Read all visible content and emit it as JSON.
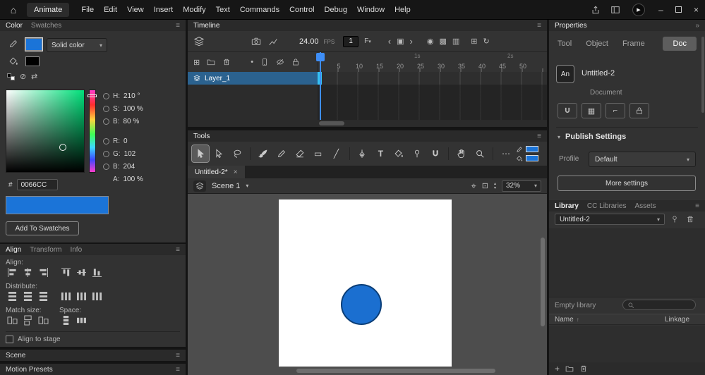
{
  "app": {
    "name": "Animate"
  },
  "menubar": {
    "items": [
      "File",
      "Edit",
      "View",
      "Insert",
      "Modify",
      "Text",
      "Commands",
      "Control",
      "Debug",
      "Window",
      "Help"
    ]
  },
  "icons": {
    "home": "⌂",
    "hamburger": "≡",
    "double_chevron": "»",
    "chevron_down": "▾",
    "close": "×",
    "minimize": "–",
    "play": "▶",
    "prev": "‹",
    "next": "›",
    "current_frame": "▣",
    "onion": "◉",
    "onion_outline": "▩",
    "edit_multiple": "▥",
    "insert_frame": "⊞",
    "loop": "↻",
    "add_layer": "⊞",
    "dot": "•",
    "rect_tool": "▭",
    "line_tool": "╱",
    "text_tool": "T",
    "more_tools": "⋯",
    "center_stage": "⌖",
    "clip": "⊡",
    "spin_up": "▴",
    "spin_down": "▾",
    "swap": "⇄",
    "no_color": "⊘",
    "up_arrow": "↑",
    "corner": "⌐",
    "grid": "▦",
    "plus": "+"
  },
  "color_panel": {
    "tab_color": "Color",
    "tab_swatches": "Swatches",
    "fill_style": "Solid color",
    "h_label": "H:",
    "h_value": "210 °",
    "s_label": "S:",
    "s_value": "100 %",
    "b_label": "B:",
    "b_value": "80 %",
    "r_label": "R:",
    "r_value": "0",
    "g_label": "G:",
    "g_value": "102",
    "b2_label": "B:",
    "b2_value": "204",
    "a_label": "A:",
    "a_value": "100 %",
    "hex_prefix": "#",
    "hex_value": "0066CC",
    "add_to_swatches": "Add To Swatches"
  },
  "align_panel": {
    "tab_align": "Align",
    "tab_transform": "Transform",
    "tab_info": "Info",
    "align_label": "Align:",
    "distribute_label": "Distribute:",
    "match_label": "Match size:",
    "space_label": "Space:",
    "align_to_stage": "Align to stage"
  },
  "left_bottom": {
    "scene": "Scene",
    "motion_presets": "Motion Presets"
  },
  "timeline": {
    "title": "Timeline",
    "fps_value": "24.00",
    "fps_unit": "FPS",
    "frame_number": "1",
    "frame_flag": "F",
    "seconds": {
      "s1": "1s",
      "s2": "2s"
    },
    "ruler": [
      "5",
      "10",
      "15",
      "20",
      "25",
      "30",
      "35",
      "40",
      "45",
      "50"
    ],
    "layer_name": "Layer_1"
  },
  "tools_panel": {
    "title": "Tools"
  },
  "document": {
    "tab_title": "Untitled-2*",
    "scene_name": "Scene 1",
    "zoom": "32%"
  },
  "properties": {
    "title": "Properties",
    "tab_tool": "Tool",
    "tab_object": "Object",
    "tab_frame": "Frame",
    "tab_doc": "Doc",
    "active_tab": "Doc",
    "doc_badge": "An",
    "doc_name": "Untitled-2",
    "doc_kind": "Document",
    "publish_settings": "Publish Settings",
    "profile_label": "Profile",
    "profile_value": "Default",
    "more_settings": "More settings"
  },
  "library": {
    "tab_library": "Library",
    "tab_cc": "CC Libraries",
    "tab_assets": "Assets",
    "document_select": "Untitled-2",
    "empty_text": "Empty library",
    "col_name": "Name",
    "col_linkage": "Linkage"
  },
  "canvas": {
    "stage_color": "#FFFFFF",
    "shape": "circle"
  },
  "colors": {
    "accent": "#1473E6",
    "fill_blue": "#1B74D8",
    "circle_fill": "#1B6FD0",
    "circle_stroke": "#0B3E77",
    "layer_selected": "#2B628F",
    "playhead": "#3E8EF7",
    "frame_marker": "#35C2F2"
  }
}
